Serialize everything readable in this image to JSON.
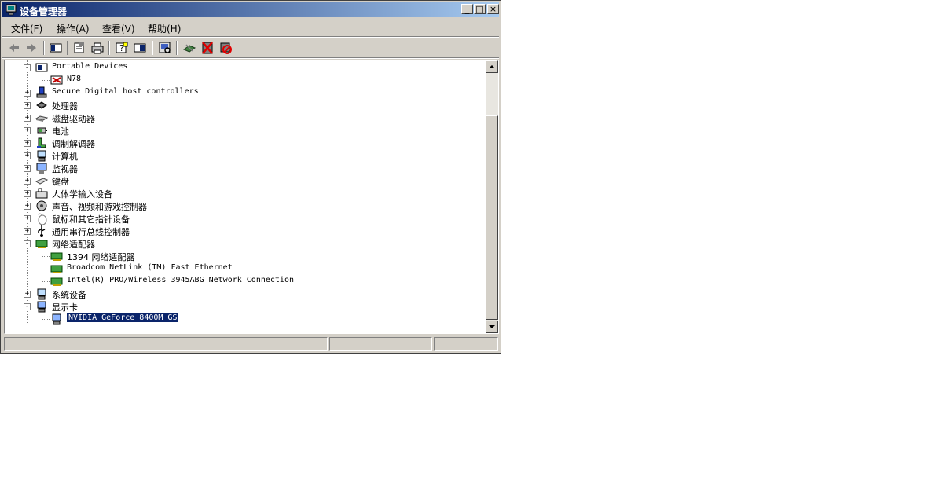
{
  "window": {
    "title": "设备管理器",
    "controls": {
      "minimize": "_",
      "maximize": "□",
      "close": "×"
    }
  },
  "menu": {
    "items": [
      {
        "label": "文件(F)"
      },
      {
        "label": "操作(A)"
      },
      {
        "label": "查看(V)"
      },
      {
        "label": "帮助(H)"
      }
    ]
  },
  "toolbar": {
    "icons": [
      "back-icon",
      "forward-icon",
      "show-hide-tree-icon",
      "properties-icon",
      "print-icon",
      "help-icon",
      "console-view-icon",
      "scan-hardware-icon",
      "update-driver-icon",
      "uninstall-icon",
      "disable-icon"
    ]
  },
  "tree": {
    "items": [
      {
        "label": "Portable Devices",
        "expander": "−",
        "icon": "portable-device-icon"
      },
      {
        "label": "N78",
        "icon": "phone-icon"
      },
      {
        "label": "Secure Digital host controllers",
        "expander": "+",
        "icon": "sd-controller-icon"
      },
      {
        "label": "处理器",
        "expander": "+",
        "icon": "processor-icon"
      },
      {
        "label": "磁盘驱动器",
        "expander": "+",
        "icon": "disk-drive-icon"
      },
      {
        "label": "电池",
        "expander": "+",
        "icon": "battery-icon"
      },
      {
        "label": "调制解调器",
        "expander": "+",
        "icon": "modem-icon"
      },
      {
        "label": "计算机",
        "expander": "+",
        "icon": "computer-icon"
      },
      {
        "label": "监视器",
        "expander": "+",
        "icon": "monitor-icon"
      },
      {
        "label": "键盘",
        "expander": "+",
        "icon": "keyboard-icon"
      },
      {
        "label": "人体学输入设备",
        "expander": "+",
        "icon": "hid-icon"
      },
      {
        "label": "声音、视频和游戏控制器",
        "expander": "+",
        "icon": "sound-icon"
      },
      {
        "label": "鼠标和其它指针设备",
        "expander": "+",
        "icon": "mouse-icon"
      },
      {
        "label": "通用串行总线控制器",
        "expander": "+",
        "icon": "usb-icon"
      },
      {
        "label": "网络适配器",
        "expander": "−",
        "icon": "network-adapter-icon"
      },
      {
        "label": "1394 网络适配器",
        "icon": "network-card-icon"
      },
      {
        "label": "Broadcom NetLink (TM) Fast Ethernet",
        "icon": "network-card-icon"
      },
      {
        "label": "Intel(R) PRO/Wireless 3945ABG Network Connection",
        "icon": "network-card-icon"
      },
      {
        "label": "系统设备",
        "expander": "+",
        "icon": "system-device-icon"
      },
      {
        "label": "显示卡",
        "expander": "−",
        "icon": "display-adapter-icon"
      },
      {
        "label": "NVIDIA GeForce 8400M GS",
        "icon": "display-card-icon"
      }
    ]
  },
  "statusbar": {
    "panes": [
      "",
      "",
      ""
    ]
  }
}
